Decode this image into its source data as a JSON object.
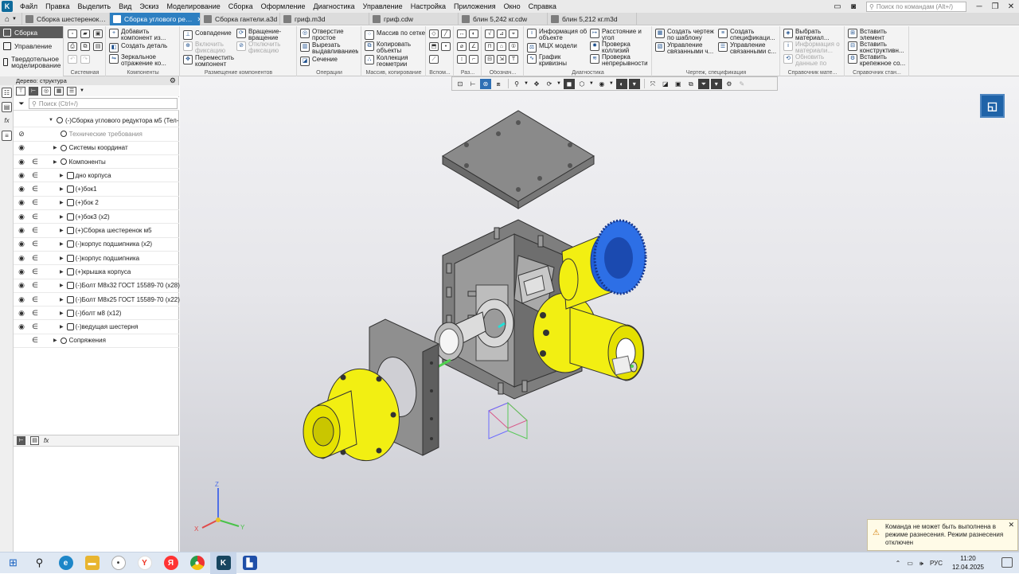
{
  "menubar": {
    "items": [
      "Файл",
      "Правка",
      "Выделить",
      "Вид",
      "Эскиз",
      "Моделирование",
      "Сборка",
      "Оформление",
      "Диагностика",
      "Управление",
      "Настройка",
      "Приложения",
      "Окно",
      "Справка"
    ],
    "search_placeholder": "Поиск по командам (Alt+/)"
  },
  "tabs": [
    {
      "label": "Сборка шестеренок…",
      "active": false
    },
    {
      "label": "Сборка углового ре…",
      "active": true
    },
    {
      "label": "Сборка гантели.a3d",
      "active": false
    },
    {
      "label": "гриф.m3d",
      "active": false
    },
    {
      "label": "гриф.cdw",
      "active": false
    },
    {
      "label": "блин 5,242 кг.cdw",
      "active": false
    },
    {
      "label": "блин 5,212 кг.m3d",
      "active": false
    }
  ],
  "leftnav": {
    "items": [
      "Сборка",
      "Управление",
      "Твердотельное моделирование"
    ]
  },
  "ribbon": {
    "groups": {
      "sistemnaya": "Системная",
      "komponenty": "Компоненты",
      "razmeshchenie": "Размещение компонентов",
      "operatsii": "Операции",
      "massiv": "Массив, копирование",
      "vspom": "Вспом...",
      "raz": "Раз...",
      "oboznach": "Обознач...",
      "diagnostika": "Диагностика",
      "chertezh": "Чертеж, спецификация",
      "spravochnik": "Справочник мате...",
      "spravochnik2": "Справочник стан..."
    },
    "buttons": {
      "add_component": "Добавить компонент из...",
      "create_part": "Создать деталь",
      "mirror_component": "Зеркальное отражение ко...",
      "coincidence": "Совпадение",
      "enable_fix": "Включить фиксацию",
      "move_component": "Переместить компонент",
      "rotation": "Вращение-вращение",
      "disable_fix": "Отключить фиксацию",
      "simple_hole": "Отверстие простое",
      "extrude_cut": "Вырезать выдавливанием",
      "section": "Сечение",
      "grid_array": "Массив по сетке",
      "copy_objects": "Копировать объекты",
      "geometry_collection": "Коллекция геометрии",
      "object_info": "Информация об объекте",
      "mcc_model": "МЦХ модели",
      "curvature_graph": "График кривизны",
      "distance_angle": "Расстояние и угол",
      "check_collisions": "Проверка коллизий",
      "check_continuity": "Проверка непрерывности",
      "create_drawing": "Создать чертеж по шаблону",
      "manage_linked_drawings": "Управление связанными ч...",
      "create_spec": "Создать спецификаци...",
      "manage_linked_spec": "Управление связанными с...",
      "choose_material": "Выбрать материал...",
      "material_info": "Информация о материали...",
      "update_material": "Обновить данные по мат...",
      "insert_element": "Вставить элемент",
      "insert_structural": "Вставить конструктивн...",
      "insert_fastener": "Вставить крепежное со..."
    }
  },
  "tree": {
    "header": "Дерево: структура",
    "search_placeholder": "Поиск (Ctrl+/)",
    "rows": [
      {
        "label": "(-)Сборка углового редуктора м5 (Тел-",
        "indent": 0,
        "eye": "",
        "ref": ""
      },
      {
        "label": "Технические требования",
        "indent": 1,
        "eye": "hidden",
        "ref": "",
        "gray": true
      },
      {
        "label": "Системы координат",
        "indent": 1,
        "eye": "eye",
        "ref": ""
      },
      {
        "label": "Компоненты",
        "indent": 1,
        "eye": "eye",
        "ref": "ref"
      },
      {
        "label": "дно корпуса",
        "indent": 2,
        "eye": "eye",
        "ref": "ref"
      },
      {
        "label": "(+)бок1",
        "indent": 2,
        "eye": "eye",
        "ref": "ref"
      },
      {
        "label": "(+)бок 2",
        "indent": 2,
        "eye": "eye",
        "ref": "ref"
      },
      {
        "label": "(+)бок3 (x2)",
        "indent": 2,
        "eye": "eye",
        "ref": "ref"
      },
      {
        "label": "(+)Сборка шестеренок м5",
        "indent": 2,
        "eye": "eye",
        "ref": "ref"
      },
      {
        "label": "(-)корпус подшипника (x2)",
        "indent": 2,
        "eye": "eye",
        "ref": "ref"
      },
      {
        "label": "(-)корпус подшипника",
        "indent": 2,
        "eye": "eye",
        "ref": "ref"
      },
      {
        "label": "(+)крышка корпуса",
        "indent": 2,
        "eye": "eye",
        "ref": "ref"
      },
      {
        "label": "(-)Болт М8х32 ГОСТ 15589-70 (x28)",
        "indent": 2,
        "eye": "eye",
        "ref": "ref"
      },
      {
        "label": "(-)Болт М8х25 ГОСТ 15589-70 (x22)",
        "indent": 2,
        "eye": "eye",
        "ref": "ref"
      },
      {
        "label": "(-)болт м8 (x12)",
        "indent": 2,
        "eye": "eye",
        "ref": "ref"
      },
      {
        "label": "(-)ведущая шестерня",
        "indent": 2,
        "eye": "eye",
        "ref": "ref"
      },
      {
        "label": "Сопряжения",
        "indent": 1,
        "eye": "",
        "ref": "ref"
      }
    ]
  },
  "viewport": {
    "axes": {
      "x": "X",
      "y": "Y",
      "z": "Z"
    }
  },
  "toast": {
    "message": "Команда не может быть выполнена в режиме разнесения. Режим разнесения отключен"
  },
  "taskbar": {
    "lang": "РУС",
    "time": "11:20",
    "date": "12.04.2025"
  },
  "colors": {
    "accent": "#2d7fc1",
    "part_yellow": "#f2ef12",
    "part_gray": "#8c8c8c",
    "gear_blue": "#1f5ed8"
  }
}
